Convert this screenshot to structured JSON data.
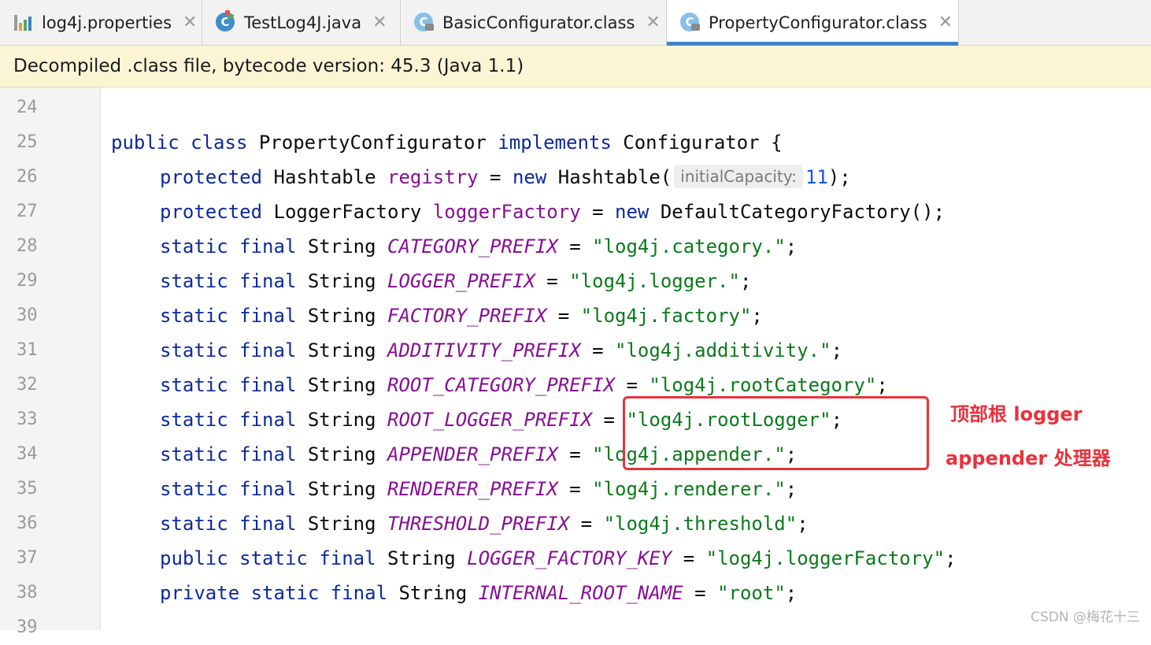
{
  "tabs": [
    {
      "label": "log4j.properties",
      "icon": "properties-file-icon",
      "active": false
    },
    {
      "label": "TestLog4J.java",
      "icon": "java-class-icon",
      "active": false
    },
    {
      "label": "BasicConfigurator.class",
      "icon": "compiled-class-icon",
      "active": false
    },
    {
      "label": "PropertyConfigurator.class",
      "icon": "compiled-class-icon",
      "active": true
    }
  ],
  "close_glyph": "✕",
  "class_icon_letter": "C",
  "banner": {
    "text": "Decompiled .class file, bytecode version: 45.3 (Java 1.1)"
  },
  "line_numbers": [
    "24",
    "25",
    "26",
    "27",
    "28",
    "29",
    "30",
    "31",
    "32",
    "33",
    "34",
    "35",
    "36",
    "37",
    "38",
    "39"
  ],
  "code": {
    "public": "public",
    "class": "class",
    "protected": "protected",
    "private": "private",
    "static": "static",
    "final": "final",
    "implements": "implements",
    "new": "new",
    "string": "String",
    "class_name": "PropertyConfigurator",
    "interface_name": "Configurator",
    "open_brace": " {",
    "hashtable": "Hashtable",
    "registry": "registry",
    "hashtable_ctor": "Hashtable(",
    "param_hint": "initialCapacity:",
    "capacity": "11",
    "close_call": ");",
    "logger_factory_type": "LoggerFactory",
    "logger_factory_field": "loggerFactory",
    "default_factory": "DefaultCategoryFactory();",
    "assign": " = ",
    "semicolon": ";",
    "fields": [
      {
        "name": "CATEGORY_PREFIX",
        "value": "\"log4j.category.\""
      },
      {
        "name": "LOGGER_PREFIX",
        "value": "\"log4j.logger.\""
      },
      {
        "name": "FACTORY_PREFIX",
        "value": "\"log4j.factory\""
      },
      {
        "name": "ADDITIVITY_PREFIX",
        "value": "\"log4j.additivity.\""
      },
      {
        "name": "ROOT_CATEGORY_PREFIX",
        "value": "\"log4j.rootCategory\""
      },
      {
        "name": "ROOT_LOGGER_PREFIX",
        "value": "\"log4j.rootLogger\""
      },
      {
        "name": "APPENDER_PREFIX",
        "value": "\"log4j.appender.\""
      },
      {
        "name": "RENDERER_PREFIX",
        "value": "\"log4j.renderer.\""
      },
      {
        "name": "THRESHOLD_PREFIX",
        "value": "\"log4j.threshold\""
      },
      {
        "name": "LOGGER_FACTORY_KEY",
        "value": "\"log4j.loggerFactory\""
      },
      {
        "name": "INTERNAL_ROOT_NAME",
        "value": "\"root\""
      }
    ]
  },
  "annotations": {
    "root_logger_note": "顶部根 logger",
    "appender_note": "appender 处理器"
  },
  "watermark": "CSDN @梅花十三",
  "colors": {
    "keyword": "#0c2a9c",
    "field": "#871094",
    "string": "#0b7a1c",
    "number": "#1750eb",
    "annotation": "#e8323c",
    "active_tab_underline": "#4083c9",
    "banner_bg": "#fcf5d5"
  }
}
